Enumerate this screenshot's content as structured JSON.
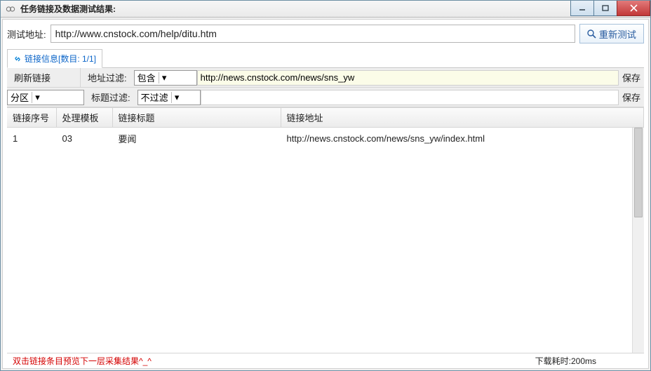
{
  "window": {
    "title": "任务链接及数据测试结果:"
  },
  "test_url": {
    "label": "测试地址:",
    "value": "http://www.cnstock.com/help/ditu.htm"
  },
  "retest_button": "重新测试",
  "tab": {
    "label": "链接信息[数目: 1/1]"
  },
  "filters": {
    "refresh": "刷新链接",
    "addr_label": "地址过滤:",
    "addr_mode": "包含",
    "addr_value": "http://news.cnstock.com/news/sns_yw",
    "addr_save": "保存",
    "partition": "分区",
    "title_label": "标题过滤:",
    "title_mode": "不过滤",
    "title_value": "",
    "title_save": "保存"
  },
  "table": {
    "headers": {
      "seq": "链接序号",
      "template": "处理模板",
      "title": "链接标题",
      "url": "链接地址"
    },
    "rows": [
      {
        "seq": "1",
        "template": "03",
        "title": "要闻",
        "url": "http://news.cnstock.com/news/sns_yw/index.html"
      }
    ]
  },
  "status": {
    "hint": "双击链接条目预览下一层采集结果^_^",
    "timing": "下载耗时:200ms"
  }
}
